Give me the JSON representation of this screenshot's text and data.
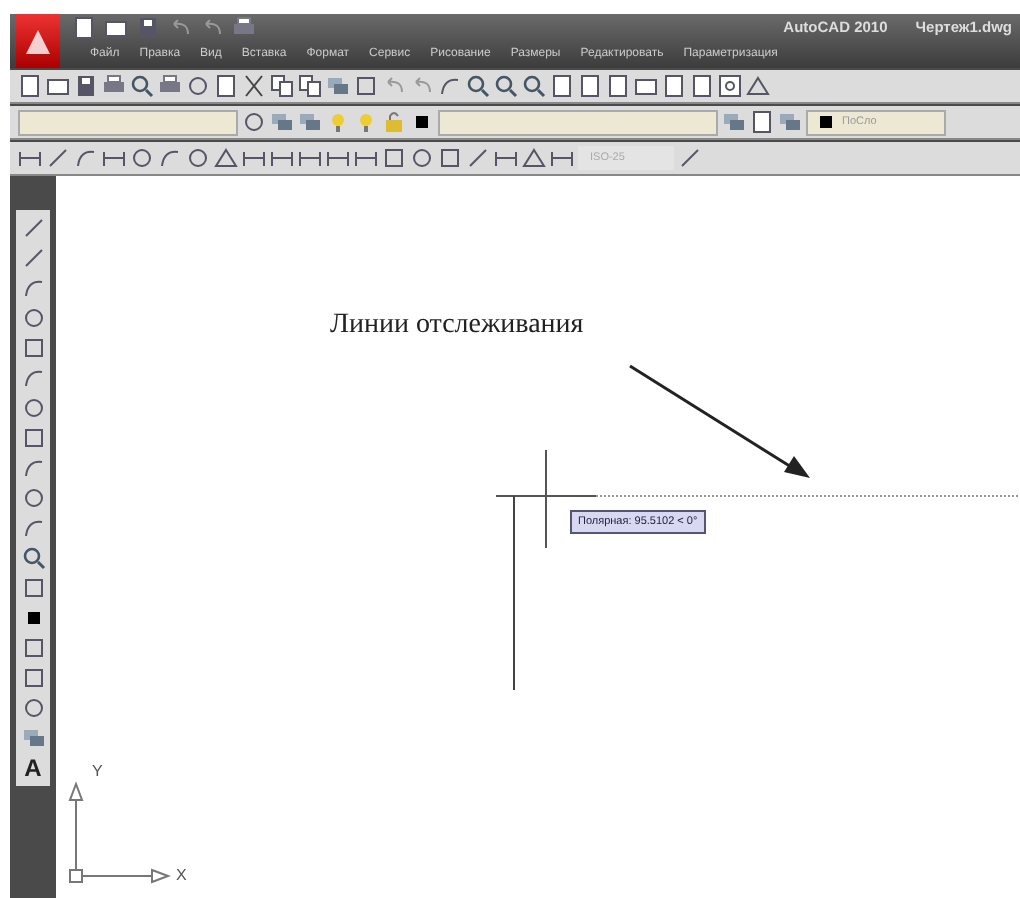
{
  "title_bar": {
    "app_title": "AutoCAD 2010",
    "file_name": "Чертеж1.dwg"
  },
  "menu": [
    {
      "label": "Файл"
    },
    {
      "label": "Правка"
    },
    {
      "label": "Вид"
    },
    {
      "label": "Вставка"
    },
    {
      "label": "Формат"
    },
    {
      "label": "Сервис"
    },
    {
      "label": "Рисование"
    },
    {
      "label": "Размеры"
    },
    {
      "label": "Редактировать"
    },
    {
      "label": "Параметризация"
    }
  ],
  "layer_toolbar": {
    "color_value": "ПоСло"
  },
  "dimension_toolbar": {
    "dim_style": "ISO-25"
  },
  "draw_toolbar": {
    "text_tool": "A"
  },
  "annotation": {
    "label": "Линии отслеживания"
  },
  "tooltip": {
    "text": "Полярная: 95.5102 < 0°"
  },
  "ucs": {
    "x_label": "X",
    "y_label": "Y"
  }
}
